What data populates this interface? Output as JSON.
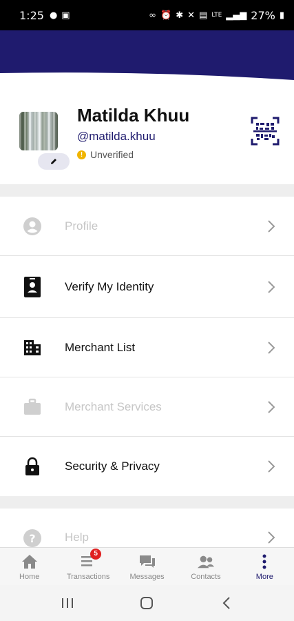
{
  "status_bar": {
    "time": "1:25",
    "battery": "27%",
    "network": "LTE"
  },
  "colors": {
    "brand": "#1f1b6e",
    "warning": "#f0b400",
    "badge": "#e02020",
    "disabled": "#c6c6c6"
  },
  "profile": {
    "name": "Matilda Khuu",
    "handle": "@matilda.khuu",
    "verification_status": "Unverified"
  },
  "menu": {
    "items": [
      {
        "label": "Profile",
        "icon": "person-circle-icon",
        "disabled": true
      },
      {
        "label": "Verify My Identity",
        "icon": "id-badge-icon",
        "disabled": false
      },
      {
        "label": "Merchant List",
        "icon": "building-icon",
        "disabled": false
      },
      {
        "label": "Merchant Services",
        "icon": "briefcase-icon",
        "disabled": true
      },
      {
        "label": "Security & Privacy",
        "icon": "lock-icon",
        "disabled": false
      },
      {
        "label": "Help",
        "icon": "help-circle-icon",
        "disabled": true
      }
    ]
  },
  "bottom_nav": {
    "tabs": [
      {
        "label": "Home",
        "icon": "home-icon"
      },
      {
        "label": "Transactions",
        "icon": "list-icon",
        "badge": "5"
      },
      {
        "label": "Messages",
        "icon": "chat-icon"
      },
      {
        "label": "Contacts",
        "icon": "contacts-icon"
      },
      {
        "label": "More",
        "icon": "more-vertical-icon",
        "active": true
      }
    ]
  }
}
